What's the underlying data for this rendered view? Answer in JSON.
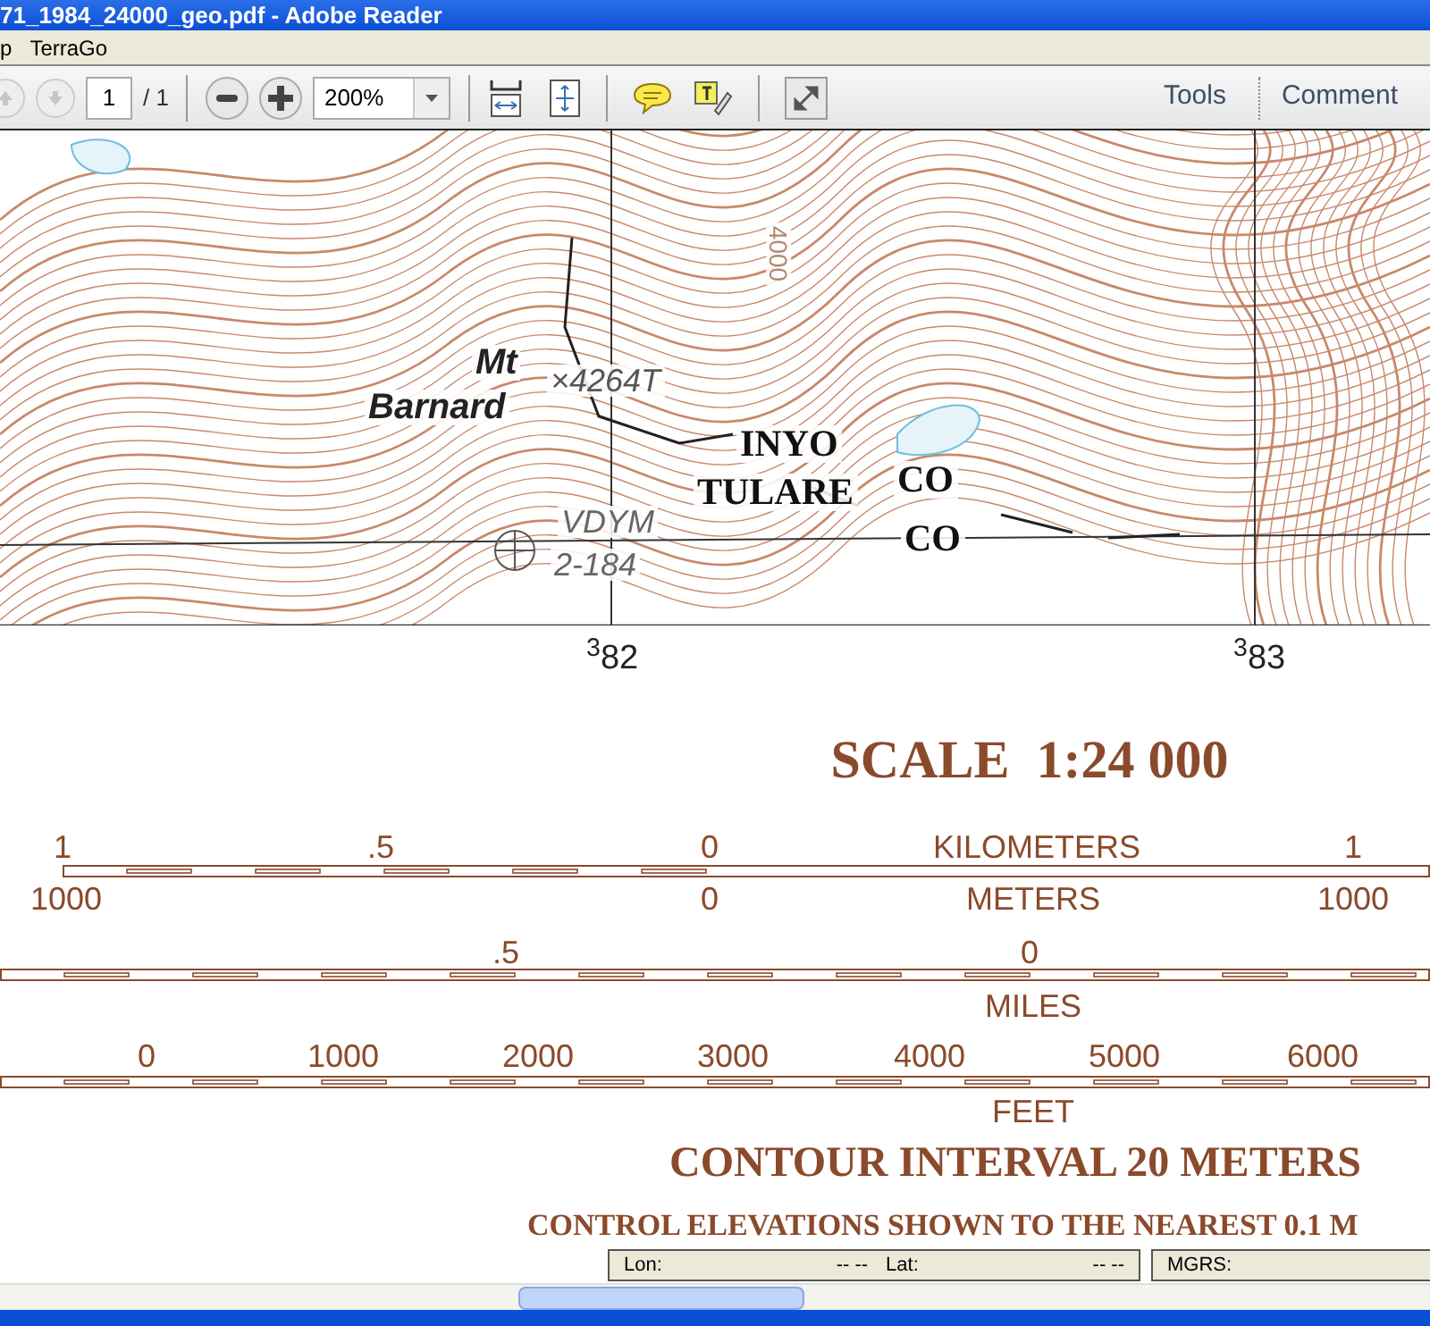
{
  "window": {
    "title": "71_1984_24000_geo.pdf - Adobe Reader"
  },
  "menu": [
    {
      "label": "p"
    },
    {
      "label": "TerraGo"
    }
  ],
  "toolbar": {
    "page": "1",
    "page_count": "/ 1",
    "zoom": "200%",
    "panes": [
      {
        "label": "Tools"
      },
      {
        "label": "Comment"
      }
    ]
  },
  "map": {
    "labels": [
      {
        "kind": "peak",
        "text": "Mt"
      },
      {
        "kind": "peak",
        "text": "Barnard"
      },
      {
        "kind": "elevation",
        "text": "×4264T"
      },
      {
        "kind": "contour",
        "text": "4000"
      },
      {
        "kind": "county",
        "text": "INYO"
      },
      {
        "kind": "county",
        "text": "CO"
      },
      {
        "kind": "county",
        "text": "TULARE"
      },
      {
        "kind": "county",
        "text": "CO"
      },
      {
        "kind": "benchmark",
        "text": "VDYM"
      },
      {
        "kind": "benchmark",
        "text": "2-184"
      },
      {
        "kind": "grid",
        "text": "$^{3}$82"
      },
      {
        "kind": "grid",
        "text": "$^{3}$83"
      }
    ]
  },
  "scale": {
    "title": "SCALE  1:24 000",
    "kilometers": {
      "unit": "KILOMETERS",
      "ticks": [
        "1",
        ".5",
        "0",
        "1"
      ]
    },
    "meters": {
      "unit": "METERS",
      "ticks": [
        "1000",
        "0",
        "1000"
      ]
    },
    "miles": {
      "unit": "MILES",
      "ticks": [
        ".5",
        "0"
      ]
    },
    "feet": {
      "unit": "FEET",
      "ticks": [
        "0",
        "1000",
        "2000",
        "3000",
        "4000",
        "5000",
        "6000"
      ]
    },
    "contour_interval": "CONTOUR INTERVAL 20 METERS",
    "control_note": "CONTROL ELEVATIONS SHOWN TO THE NEAREST 0.1 M"
  },
  "coordinates": {
    "lon_label": "Lon:",
    "lon_value": "-- --",
    "lat_label": "Lat:",
    "lat_value": "-- --",
    "mgrs_label": "MGRS:"
  }
}
